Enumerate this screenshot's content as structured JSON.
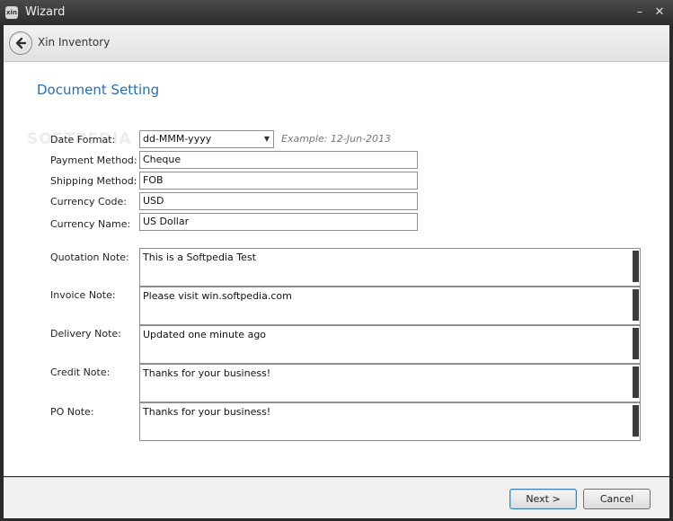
{
  "window": {
    "title": "Wizard",
    "app_icon_text": "xin",
    "minimize": "–",
    "close": "✕"
  },
  "nav": {
    "title": "Xin Inventory"
  },
  "section": {
    "title": "Document Setting"
  },
  "watermark": "SOFTPEDIA",
  "fields": {
    "date_format": {
      "label": "Date Format:",
      "value": "dd-MMM-yyyy",
      "example": "Example: 12-Jun-2013"
    },
    "payment_method": {
      "label": "Payment Method:",
      "value": "Cheque"
    },
    "shipping_method": {
      "label": "Shipping Method:",
      "value": "FOB"
    },
    "currency_code": {
      "label": "Currency Code:",
      "value": "USD"
    },
    "currency_name": {
      "label": "Currency Name:",
      "value": "US Dollar"
    }
  },
  "notes": {
    "quotation": {
      "label": "Quotation Note:",
      "value": "This is a Softpedia Test"
    },
    "invoice": {
      "label": "Invoice Note:",
      "value": "Please visit win.softpedia.com"
    },
    "delivery": {
      "label": "Delivery Note:",
      "value": "Updated one minute ago"
    },
    "credit": {
      "label": "Credit Note:",
      "value": "Thanks for your business!"
    },
    "po": {
      "label": "PO Note:",
      "value": "Thanks for your business!"
    }
  },
  "footer": {
    "next_label": "Next >",
    "cancel_label": "Cancel"
  }
}
